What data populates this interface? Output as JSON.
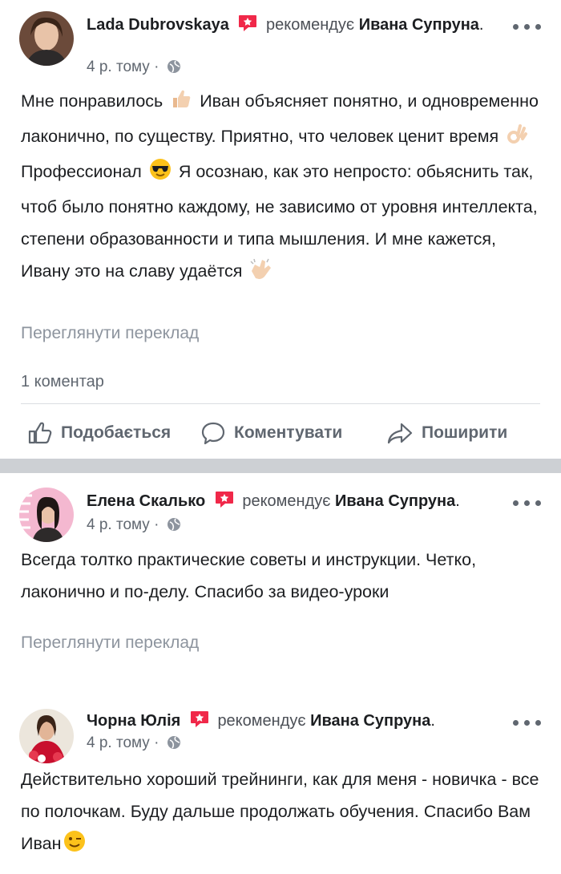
{
  "posts": [
    {
      "author": "Lada Dubrovskaya",
      "verb": "рекомендує",
      "target": "Ивана Супруна",
      "time": "4 р. тому",
      "text_parts": [
        "Мне понравилось",
        "Иван объясняет понятно, и одновременно лаконично, по существу. Приятно, что человек ценит время",
        "Профессионал",
        "Я осознаю, как это непросто: обьяснить так, чтоб было понятно каждому, не зависимо от уровня интеллекта, степени образованности и типа мышления. И мне кажется, Ивану это на славу удаётся"
      ],
      "translate": "Переглянути переклад",
      "comments": "1 коментар"
    },
    {
      "author": "Елена Скалько",
      "verb": "рекомендує",
      "target": "Ивана Супруна",
      "time": "4 р. тому",
      "text": "Всегда толтко практические советы и инструкции. Четко, лаконично и по-делу. Спасибо за видео-уроки",
      "translate": "Переглянути переклад"
    },
    {
      "author": "Чорна Юлія",
      "verb": "рекомендує",
      "target": "Ивана Супруна",
      "time": "4 р. тому",
      "text": "Действительно хороший трейнинги, как для меня - новичка - все по полочкам. Буду дальше продолжать обучения. Спасибо Вам Иван"
    }
  ],
  "actions": {
    "like": "Подобається",
    "comment": "Коментувати",
    "share": "Поширити"
  },
  "icons": {
    "recommend": "recommend-star-icon",
    "globe": "globe-icon",
    "more": "more-icon",
    "like": "thumbs-up-icon",
    "comment": "comment-icon",
    "share": "share-arrow-icon"
  },
  "colors": {
    "recommend_red": "#f02849",
    "text": "#1c1e21",
    "secondary": "#606770",
    "translate": "#8d949e",
    "separator": "#cdd0d4"
  }
}
